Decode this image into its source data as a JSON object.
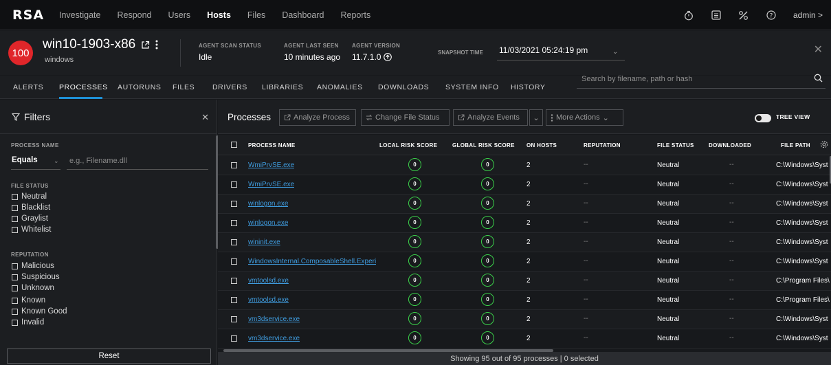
{
  "nav": {
    "logo": "RSA",
    "items": [
      "Investigate",
      "Respond",
      "Users",
      "Hosts",
      "Files",
      "Dashboard",
      "Reports"
    ],
    "active": "Hosts",
    "user": "admin >"
  },
  "host": {
    "risk_score": "100",
    "name": "win10-1903-x86",
    "os": "windows",
    "scan_status_label": "AGENT SCAN STATUS",
    "scan_status": "Idle",
    "last_seen_label": "AGENT LAST SEEN",
    "last_seen": "10 minutes ago",
    "version_label": "AGENT VERSION",
    "version": "11.7.1.0",
    "snapshot_label": "SNAPSHOT TIME",
    "snapshot_time": "11/03/2021 05:24:19 pm"
  },
  "tabs": [
    "ALERTS",
    "PROCESSES",
    "AUTORUNS",
    "FILES",
    "DRIVERS",
    "LIBRARIES",
    "ANOMALIES",
    "DOWNLOADS",
    "SYSTEM INFO",
    "HISTORY"
  ],
  "active_tab": "PROCESSES",
  "search": {
    "placeholder": "Search by filename, path or hash"
  },
  "filters": {
    "title": "Filters",
    "process_name_label": "PROCESS NAME",
    "operator": "Equals",
    "name_placeholder": "e.g., Filename.dll",
    "file_status_label": "FILE STATUS",
    "file_status_options": [
      "Neutral",
      "Blacklist",
      "Graylist",
      "Whitelist"
    ],
    "reputation_label": "REPUTATION",
    "reputation_options": [
      "Malicious",
      "Suspicious",
      "Unknown",
      "Known",
      "Known Good",
      "Invalid"
    ],
    "reset": "Reset"
  },
  "processes": {
    "title": "Processes",
    "buttons": {
      "analyze_process": "Analyze Process",
      "change_file_status": "Change File Status",
      "analyze_events": "Analyze Events",
      "more_actions": "More Actions"
    },
    "tree_view": "TREE VIEW",
    "columns": [
      "PROCESS NAME",
      "LOCAL RISK SCORE",
      "GLOBAL RISK SCORE",
      "ON HOSTS",
      "REPUTATION",
      "FILE STATUS",
      "DOWNLOADED",
      "FILE PATH"
    ],
    "rows": [
      {
        "name": "WmiPrvSE.exe",
        "local": "0",
        "global": "0",
        "hosts": "2",
        "reputation": "--",
        "status": "Neutral",
        "downloaded": "--",
        "path": "C:\\Windows\\Syst"
      },
      {
        "name": "WmiPrvSE.exe",
        "local": "0",
        "global": "0",
        "hosts": "2",
        "reputation": "--",
        "status": "Neutral",
        "downloaded": "--",
        "path": "C:\\Windows\\Syst"
      },
      {
        "name": "winlogon.exe",
        "local": "0",
        "global": "0",
        "hosts": "2",
        "reputation": "--",
        "status": "Neutral",
        "downloaded": "--",
        "path": "C:\\Windows\\Syst"
      },
      {
        "name": "winlogon.exe",
        "local": "0",
        "global": "0",
        "hosts": "2",
        "reputation": "--",
        "status": "Neutral",
        "downloaded": "--",
        "path": "C:\\Windows\\Syst"
      },
      {
        "name": "wininit.exe",
        "local": "0",
        "global": "0",
        "hosts": "2",
        "reputation": "--",
        "status": "Neutral",
        "downloaded": "--",
        "path": "C:\\Windows\\Syst"
      },
      {
        "name": "WindowsInternal.ComposableShell.Experi...",
        "local": "0",
        "global": "0",
        "hosts": "2",
        "reputation": "--",
        "status": "Neutral",
        "downloaded": "--",
        "path": "C:\\Windows\\Syst"
      },
      {
        "name": "vmtoolsd.exe",
        "local": "0",
        "global": "0",
        "hosts": "2",
        "reputation": "--",
        "status": "Neutral",
        "downloaded": "--",
        "path": "C:\\Program Files\\"
      },
      {
        "name": "vmtoolsd.exe",
        "local": "0",
        "global": "0",
        "hosts": "2",
        "reputation": "--",
        "status": "Neutral",
        "downloaded": "--",
        "path": "C:\\Program Files\\"
      },
      {
        "name": "vm3dservice.exe",
        "local": "0",
        "global": "0",
        "hosts": "2",
        "reputation": "--",
        "status": "Neutral",
        "downloaded": "--",
        "path": "C:\\Windows\\Syst"
      },
      {
        "name": "vm3dservice.exe",
        "local": "0",
        "global": "0",
        "hosts": "2",
        "reputation": "--",
        "status": "Neutral",
        "downloaded": "--",
        "path": "C:\\Windows\\Syst"
      }
    ],
    "status_text": "Showing 95 out of 95 processes | 0 selected"
  },
  "colors": {
    "accent": "#1e90d6",
    "risk_red": "#e0262a",
    "score_green": "#3bd14a",
    "link": "#3f9cdf"
  }
}
